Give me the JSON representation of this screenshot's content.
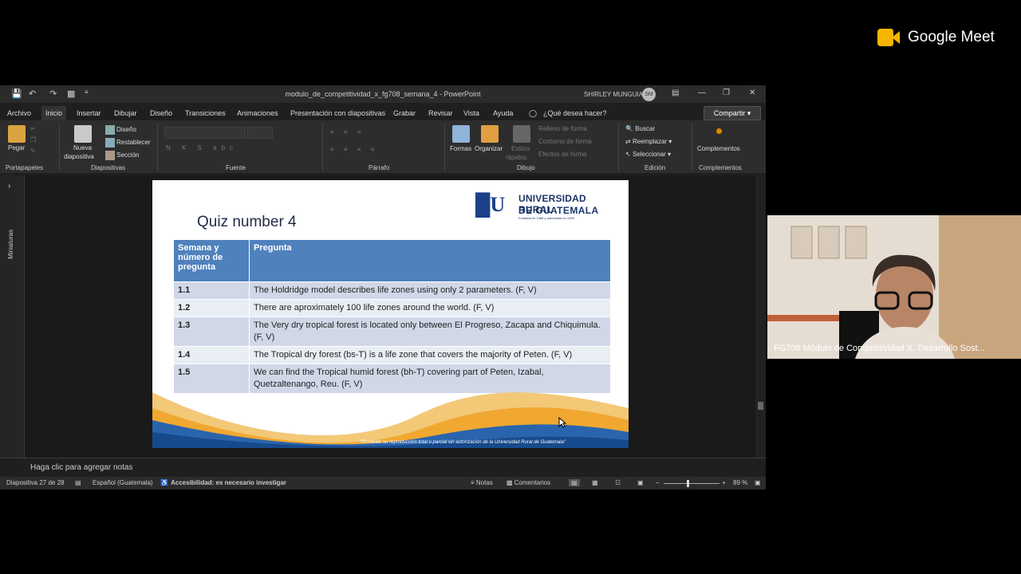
{
  "meet": {
    "brand": "Google Meet"
  },
  "window": {
    "title": "modulo_de_competitividad_x_fg708_semana_4  -  PowerPoint",
    "user": "SHIRLEY MUNGUIA",
    "user_initials": "SM"
  },
  "tabs": [
    "Archivo",
    "Inicio",
    "Insertar",
    "Dibujar",
    "Diseño",
    "Transiciones",
    "Animaciones",
    "Presentación con diapositivas",
    "Grabar",
    "Revisar",
    "Vista",
    "Ayuda"
  ],
  "tell_me": "¿Qué desea hacer?",
  "share": "Compartir",
  "ribbon": {
    "pegar": "Pegar",
    "nueva1": "Nueva",
    "nueva2": "diapositiva",
    "diseno": "Diseño",
    "restablecer": "Restablecer",
    "seccion": "Sección",
    "formas": "Formas",
    "organizar": "Organizar",
    "estilos1": "Estilos",
    "estilos2": "rápidos",
    "relleno": "Relleno de forma",
    "contorno": "Contorno de forma",
    "efectos": "Efectos de forma",
    "buscar": "Buscar",
    "reemplazar": "Reemplazar",
    "seleccionar": "Seleccionar",
    "complementos": "Complementos",
    "groups": {
      "portapapeles": "Portapapeles",
      "diapositivas": "Diapositivas",
      "fuente": "Fuente",
      "parrafo": "Párrafo",
      "dibujo": "Dibujo",
      "edicion": "Edición",
      "complementos": "Complementos"
    }
  },
  "left_panel": "Miniaturas",
  "slide": {
    "title": "Quiz number 4",
    "logo_line1": "UNIVERSIDAD RURAL",
    "logo_line2": "DE GUATEMALA",
    "logo_line3": "Fundada en 1988 y autorizada en 1995",
    "headers": [
      "Semana y número de pregunta",
      "Pregunta"
    ],
    "rows": [
      {
        "num": "1.1",
        "q": "The Holdridge model describes life zones using only 2 parameters. (F, V)"
      },
      {
        "num": "1.2",
        "q": "There are aproximately 100 life zones around the world. (F, V)"
      },
      {
        "num": "1.3",
        "q": "The Very dry tropical forest is located only between El Progreso, Zacapa and Chiquimula. (F, V)"
      },
      {
        "num": "1.4",
        "q": "The Tropical dry forest (bs-T) is a life zone that covers the majority of Peten. (F, V)"
      },
      {
        "num": "1.5",
        "q": "We can find the Tropical humid forest (bh-T) covering part of Peten, Izabal, Quetzaltenango, Reu. (F, V)"
      }
    ],
    "footer": "\"Prohibido su reproducción total o parcial sin autorización de la Universidad Rural de Guatemala\""
  },
  "notes": "Haga clic para agregar notas",
  "status": {
    "slide": "Diapositiva 27 de 28",
    "language": "Español (Guatemala)",
    "accessibility": "Accesibilidad: es necesario investigar",
    "notes_btn": "Notas",
    "comments_btn": "Comentarios",
    "zoom": "89 %"
  },
  "participant": {
    "name": "FG708 Módulo de Competitividad X. Desarrollo Sost..."
  }
}
